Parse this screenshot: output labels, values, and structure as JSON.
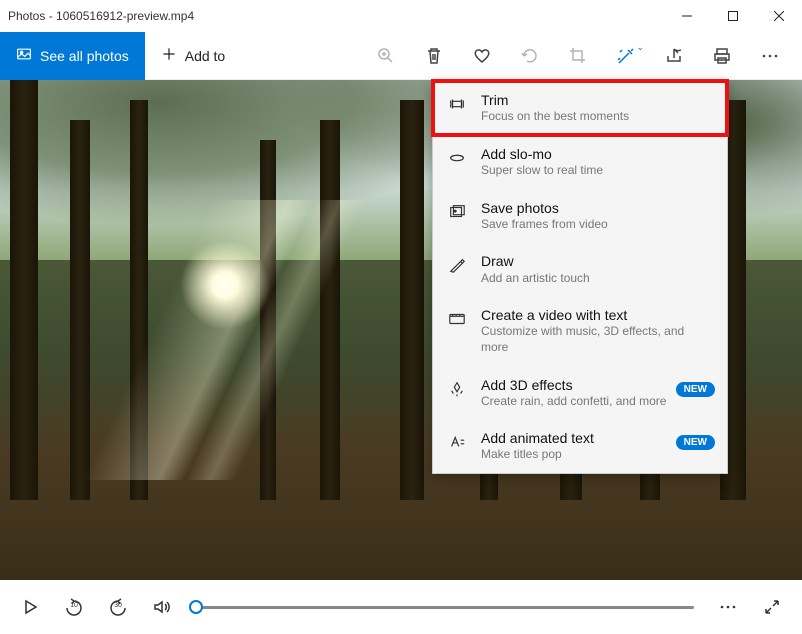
{
  "window": {
    "title": "Photos - 1060516912-preview.mp4"
  },
  "toolbar": {
    "see_all": "See all photos",
    "add_to": "Add to"
  },
  "dropdown": {
    "items": [
      {
        "title": "Trim",
        "sub": "Focus on the best moments",
        "highlighted": true
      },
      {
        "title": "Add slo-mo",
        "sub": "Super slow to real time"
      },
      {
        "title": "Save photos",
        "sub": "Save frames from video"
      },
      {
        "title": "Draw",
        "sub": "Add an artistic touch"
      },
      {
        "title": "Create a video with text",
        "sub": "Customize with music, 3D effects, and more"
      },
      {
        "title": "Add 3D effects",
        "sub": "Create rain, add confetti, and more",
        "badge": "NEW"
      },
      {
        "title": "Add animated text",
        "sub": "Make titles pop",
        "badge": "NEW"
      }
    ]
  },
  "playback": {
    "skip_back": "10",
    "skip_fwd": "30"
  }
}
